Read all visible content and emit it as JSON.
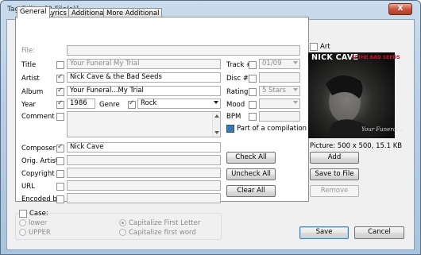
{
  "window": {
    "title": "Tag Editor [9 File(s)]",
    "close_label": "X"
  },
  "tabs": [
    "General",
    "Lyrics",
    "Additional",
    "More Additional"
  ],
  "fields": {
    "file_label": "File:",
    "title_label": "Title",
    "title_value": "Your Funeral My Trial",
    "artist_label": "Artist",
    "artist_value": "Nick Cave & the Bad Seeds",
    "album_label": "Album",
    "album_value": "Your Funeral...My Trial",
    "year_label": "Year",
    "year_value": "1986",
    "genre_label": "Genre",
    "genre_value": "Rock",
    "comment_label": "Comment",
    "composer_label": "Composer",
    "composer_value": "Nick Cave",
    "orig_artist_label": "Orig. Artist",
    "copyright_label": "Copyright",
    "url_label": "URL",
    "encoded_by_label": "Encoded by"
  },
  "right_fields": {
    "track_label": "Track #",
    "track_value": "01/09",
    "disc_label": "Disc #",
    "rating_label": "Rating",
    "rating_value": "5 Stars",
    "mood_label": "Mood",
    "bpm_label": "BPM",
    "compilation_label": "Part of a compilation"
  },
  "check_buttons": {
    "check_all": "Check All",
    "uncheck_all": "Uncheck All",
    "clear_all": "Clear All"
  },
  "art": {
    "label": "Art",
    "cover_band_text": "NICK CAVE",
    "cover_band_text2": "& THE BAD SEEDS",
    "cover_script": "Your Funeral...",
    "picture_info": "Picture: 500 x 500, 15.1 KB",
    "add": "Add",
    "save_to_file": "Save to File",
    "remove": "Remove"
  },
  "case_group": {
    "label": "Case:",
    "options_left": [
      "lower",
      "UPPER"
    ],
    "options_right": [
      "Capitalize First Letter",
      "Capitalize first word"
    ],
    "selected": "Capitalize First Letter"
  },
  "footer": {
    "save": "Save",
    "cancel": "Cancel"
  },
  "colors": {
    "title_bar": "#b7cfe5",
    "default_button": "#3c7fb1",
    "cover_red": "#c8102e"
  }
}
